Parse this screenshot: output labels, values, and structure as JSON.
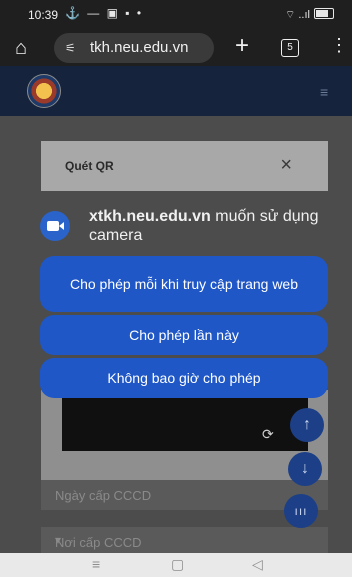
{
  "status_bar": {
    "time": "10:39",
    "left_icons": "⚓ — ▣ ▪ •",
    "right_icons": "⌔ ..ıl",
    "battery_label": "battery-icon"
  },
  "browser": {
    "url": "tkh.neu.edu.vn",
    "tab_count": "5",
    "icons": {
      "home": "home-icon",
      "site_settings": "tune-icon",
      "new_tab": "plus-icon",
      "tabs": "tabs-icon",
      "menu": "kebab-menu-icon"
    }
  },
  "qr_dialog": {
    "title": "Quét QR",
    "close": "×"
  },
  "permission": {
    "site": "xtkh.neu.edu.vn",
    "message": " muốn sử dụng camera",
    "allow_every_visit": "Cho phép mỗi khi truy cập trang web",
    "allow_once": "Cho phép lần này",
    "never_allow": "Không bao giờ cho phép",
    "accent_color": "#1f57c7"
  },
  "form": {
    "field_date": "Ngày cấp CCCD",
    "field_place": "Nơi cấp CCCD"
  },
  "fabs": {
    "up": "↑",
    "down": "↓",
    "sort": "ııı"
  }
}
